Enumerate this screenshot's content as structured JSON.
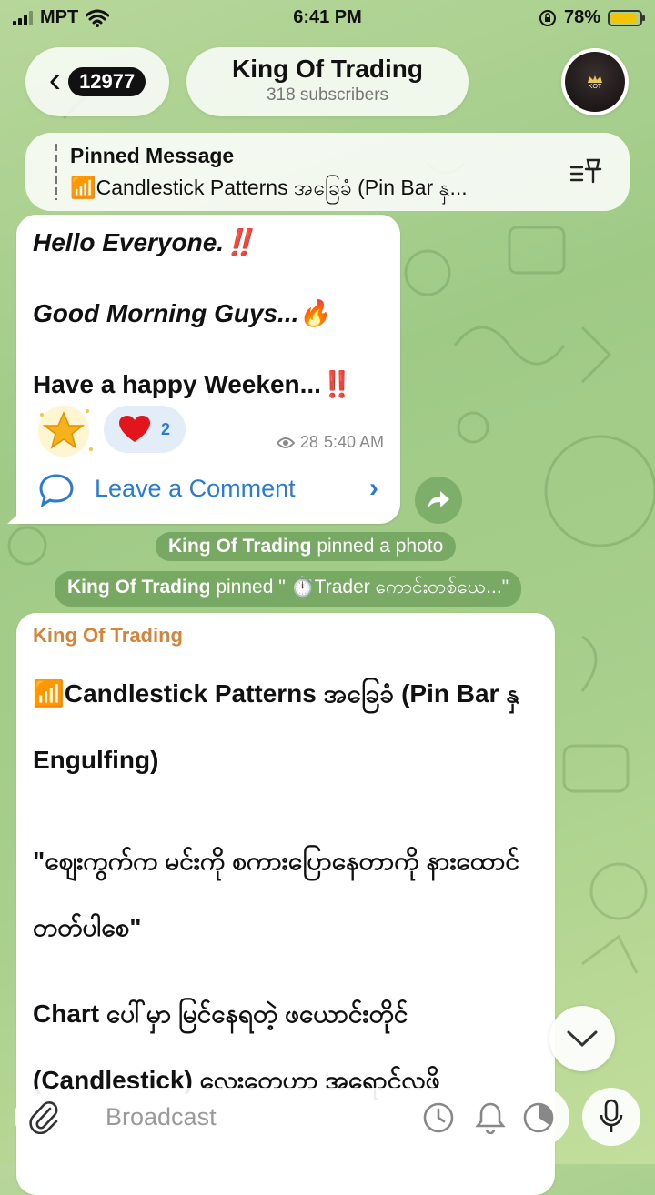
{
  "status_bar": {
    "carrier": "MPT",
    "time": "6:41 PM",
    "battery": "78%"
  },
  "header": {
    "back_count": "12977",
    "channel_name": "King Of Trading",
    "subscribers": "318 subscribers"
  },
  "pinned": {
    "label": "Pinned Message",
    "text": "📶Candlestick Patterns အခြေခံ (Pin Bar နှ..."
  },
  "message1": {
    "line1": "Hello Everyone.‼️",
    "line2": "Good Morning Guys...🔥",
    "line3": "Have a happy Weeken...‼️",
    "star_reaction": "⭐",
    "heart_reaction": "❤️",
    "heart_count": "2",
    "views": "28",
    "time": "5:40 AM",
    "comment_label": "Leave a Comment"
  },
  "service": {
    "s1_name": "King Of Trading",
    "s1_text": " pinned a photo",
    "s2_name": "King Of Trading",
    "s2_text": " pinned \" ⏱️Trader ကောင်းတစ်ယေ...\""
  },
  "message2": {
    "author": "King Of Trading",
    "para1": "📶Candlestick Patterns အခြေခံ (Pin Bar နှ Engulfing)",
    "para2": " \"ဈေးကွက်က မင်းကို စကားပြောနေတာကို နားထောင်တတ်ပါစေ\"",
    "para3": "Chart ပေါ်မှာ မြင်နေရတဲ့ ဖယောင်းတိုင် (Candlestick) လေးတေဟာ အရောင်လဖိ"
  },
  "input": {
    "placeholder": "Broadcast"
  },
  "colors": {
    "link": "#2a7bd3",
    "author": "#d58536"
  }
}
